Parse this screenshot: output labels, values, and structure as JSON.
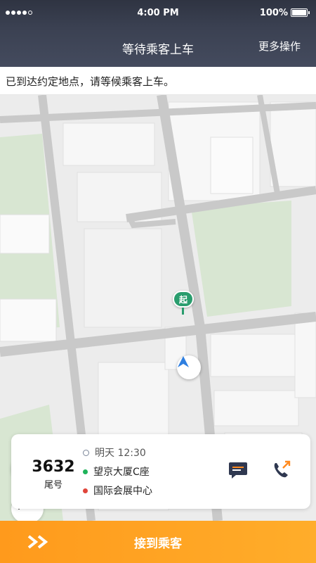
{
  "status_bar": {
    "time": "4:00 PM",
    "battery": "100%"
  },
  "nav": {
    "title": "等待乘客上车",
    "more_label": "更多操作"
  },
  "notice": {
    "text": "已到达约定地点，请等候乘客上车。"
  },
  "map": {
    "pickup_marker_label": "起",
    "colors": {
      "road": "#c9c9c9",
      "block": "#f7f7f7",
      "park": "#d8e6d2",
      "accent": "#2a9d6e",
      "nav_arrow": "#2f7fe0"
    }
  },
  "traffic_lights": [
    "#e0453a",
    "#f2b91f",
    "#2fbf5b"
  ],
  "trip_card": {
    "tail_number": "3632",
    "tail_label": "尾号",
    "time": "明天 12:30",
    "from": "望京大厦C座",
    "to": "国际会展中心",
    "colors": {
      "from_dot": "#1fb35a",
      "to_dot": "#e0453a",
      "message_icon": "#2f3850",
      "call_icon": "#2f3850",
      "call_accent": "#ff8a1f"
    }
  },
  "bottom_action": {
    "label": "接到乘客"
  },
  "icons": {
    "message": "message-icon",
    "call": "call-icon",
    "locate": "locate-icon",
    "traffic": "traffic-icon",
    "forward": "double-chevron-icon"
  }
}
